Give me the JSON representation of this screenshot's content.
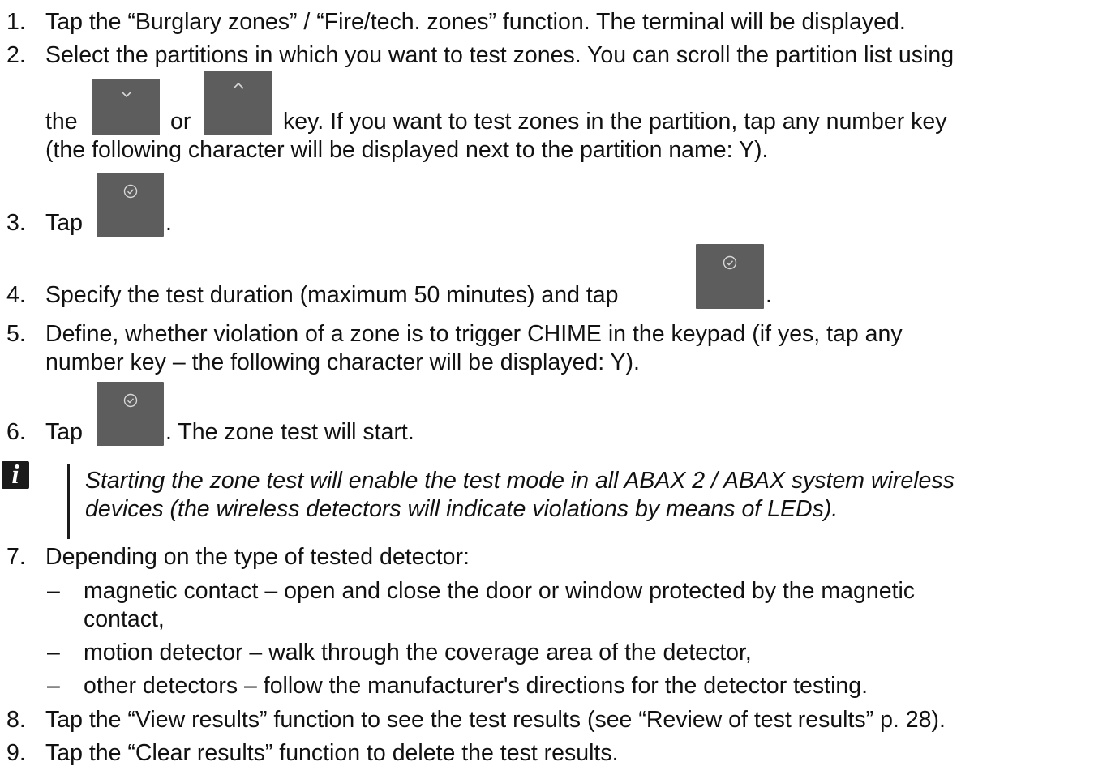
{
  "steps": [
    {
      "num": "1.",
      "lines": [
        "Tap the “Burglary zones” / “Fire/tech. zones” function. The terminal will be displayed."
      ]
    },
    {
      "num": "2.",
      "lines": [
        "Select the partitions in which you want to test zones. You can scroll the partition list using",
        "the",
        "or",
        "key. If you want to test zones in the partition, tap any number key",
        "(the following character will be displayed next to the partition name: Y)."
      ]
    },
    {
      "num": "3.",
      "lines": [
        "Tap",
        "."
      ]
    },
    {
      "num": "4.",
      "lines": [
        "Specify the test duration (maximum 50 minutes) and tap",
        "."
      ]
    },
    {
      "num": "5.",
      "lines": [
        "Define, whether violation of a zone is to trigger CHIME in the keypad (if yes, tap any",
        "number key – the following character will be displayed: Y)."
      ]
    },
    {
      "num": "6.",
      "lines": [
        "Tap",
        ". The zone test will start."
      ]
    },
    {
      "num": "7.",
      "lines": [
        "Depending on the type of tested detector:"
      ]
    },
    {
      "num": "8.",
      "lines": [
        "Tap the “View results” function to see the test results (see “Review of test results” p. 28)."
      ]
    },
    {
      "num": "9.",
      "lines": [
        "Tap the “Clear results” function to delete the test results."
      ]
    }
  ],
  "note": {
    "icon": "i",
    "lines": [
      "Starting the zone test will enable the test mode in all ABAX 2 / ABAX system wireless",
      "devices (the wireless detectors will indicate violations by means of LEDs)."
    ]
  },
  "sub_items": [
    {
      "dash": "–",
      "lines": [
        "magnetic contact – open and close the door or window protected by the magnetic",
        "contact,"
      ]
    },
    {
      "dash": "–",
      "lines": [
        "motion detector – walk through the coverage area of the detector,"
      ]
    },
    {
      "dash": "–",
      "lines": [
        "other detectors – follow the manufacturer's directions for the detector testing."
      ]
    }
  ],
  "icons": {
    "down_key": "chevron-down-icon",
    "up_key": "chevron-up-icon",
    "confirm_key": "check-circle-icon",
    "key_color": "#5d5d5d"
  }
}
